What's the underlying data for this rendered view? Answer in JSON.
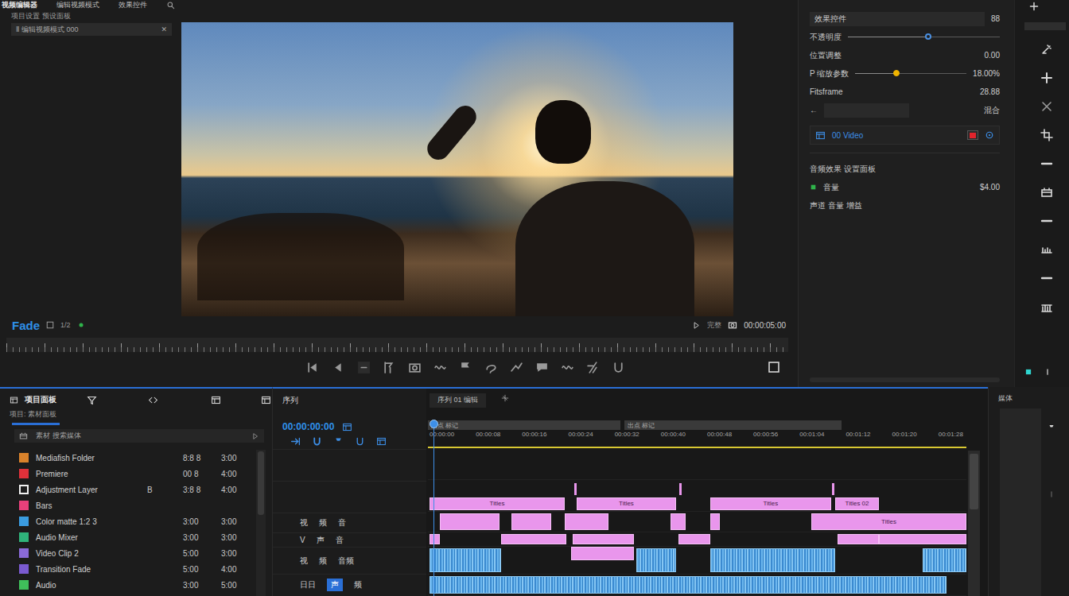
{
  "editor": {
    "title": "视频编辑器",
    "menu": [
      "编辑视频模式",
      "效果控件"
    ],
    "subtitle": "项目设置 预设面板",
    "preset_field": {
      "value": "Ⅱ 编辑视频模式 000",
      "clear": "✕"
    }
  },
  "viewer": {
    "clip_name": "Fade",
    "zoom": "1/2",
    "view_mode": "完整",
    "timecode": "00:00:05:00"
  },
  "effect_controls": {
    "header": {
      "label": "效果控件",
      "value": "88"
    },
    "params": [
      {
        "kind": "slider",
        "label": "不透明度",
        "level": 0.53,
        "color": "#4a8fe0"
      },
      {
        "kind": "value",
        "label": "位置调整",
        "value": "0.00"
      },
      {
        "kind": "slider",
        "label": "P 缩放参数",
        "level": 0.37,
        "color": "#f0b400",
        "value": "18.00%"
      },
      {
        "kind": "value",
        "label": "Fitsframe",
        "value": "28.88"
      },
      {
        "kind": "dropdown",
        "label": "←",
        "value": "混合"
      }
    ],
    "keyframe": {
      "label": "00 Video",
      "record_on": true
    },
    "audio": {
      "title": "音频效果 设置面板",
      "rows": [
        {
          "label": "音量",
          "value": "$4.00"
        },
        {
          "label": "声道 音量 增益"
        }
      ]
    }
  },
  "project": {
    "title": "项目面板",
    "subtitle": "项目: 素材面板",
    "search": "素材 搜索媒体",
    "items": [
      {
        "name": "Mediafish Folder",
        "a": "8:8 8",
        "b": "3:00",
        "color": "#d9822b"
      },
      {
        "name": "Premiere",
        "a": "00 8",
        "b": "4:00",
        "color": "#e0313a"
      },
      {
        "name": "Adjustment Layer",
        "ex": "B",
        "a": "3:8 8",
        "b": "4:00",
        "color": "#f0f0f0"
      },
      {
        "name": "Bars",
        "color": "#e8407a"
      },
      {
        "name": "Color matte 1:2 3",
        "a": "3:00",
        "b": "3:00",
        "color": "#3a9be0"
      },
      {
        "name": "Audio Mixer",
        "a": "3:00",
        "b": "3:00",
        "color": "#2fb37a"
      },
      {
        "name": "Video Clip 2",
        "a": "5:00",
        "b": "3:00",
        "color": "#8a6ad8"
      },
      {
        "name": "Transition Fade",
        "a": "5:00",
        "b": "4:00",
        "color": "#7a5ad0"
      },
      {
        "name": "Audio",
        "a": "3:00",
        "b": "5:00",
        "color": "#3fbf5a"
      }
    ]
  },
  "timeline": {
    "title": "序列",
    "sequence_tab": "序列 01 编辑",
    "timecode": "00:00:00:00",
    "ranges": [
      {
        "start": 0,
        "end": 35.7,
        "label": "入点 标记"
      },
      {
        "start": 36.5,
        "end": 76.8,
        "label": "出点 标记"
      }
    ],
    "ruler": [
      "00:00:00",
      "00:00:08",
      "00:00:16",
      "00:00:24",
      "00:00:32",
      "00:00:40",
      "00:00:48",
      "00:00:56",
      "00:01:04",
      "00:01:12",
      "00:01:20",
      "00:01:28"
    ],
    "playhead": 1,
    "tracks": [
      {
        "header": [],
        "markers": [],
        "clips": []
      },
      {
        "header": [],
        "markers": [
          27.3,
          46.8,
          75.2
        ],
        "clips": [
          {
            "kind": "video",
            "start": 0.3,
            "end": 25.4,
            "label": "Titles"
          },
          {
            "kind": "video",
            "start": 27.6,
            "end": 46.1,
            "label": "Titles"
          },
          {
            "kind": "video",
            "start": 52.4,
            "end": 74.9,
            "label": "Titles"
          },
          {
            "kind": "video",
            "start": 75.6,
            "end": 83.8,
            "label": "Titles 02"
          }
        ]
      },
      {
        "header": [
          {
            "text": "视",
            "selected": false
          },
          {
            "text": "频",
            "selected": false
          },
          {
            "text": "音",
            "selected": false
          }
        ],
        "markers": [],
        "clips": [
          {
            "kind": "video",
            "start": 2.2,
            "end": 13.3
          },
          {
            "kind": "video",
            "start": 15.5,
            "end": 22.9
          },
          {
            "kind": "video",
            "start": 25.4,
            "end": 33.5
          },
          {
            "kind": "video",
            "start": 45.1,
            "end": 47.9
          },
          {
            "kind": "video",
            "start": 52.4,
            "end": 54.2
          },
          {
            "kind": "video",
            "start": 71.2,
            "end": 100,
            "label": "Titles"
          }
        ]
      },
      {
        "header": [
          {
            "text": "V",
            "selected": false
          },
          {
            "text": "声",
            "selected": false
          },
          {
            "text": "音",
            "selected": false
          }
        ],
        "markers": [],
        "clips": [
          {
            "kind": "video",
            "start": 0.3,
            "end": 2.2
          },
          {
            "kind": "video",
            "start": 13.6,
            "end": 25.7
          },
          {
            "kind": "video",
            "start": 26.9,
            "end": 38.3
          },
          {
            "kind": "video",
            "start": 46.5,
            "end": 52.4
          },
          {
            "kind": "video",
            "start": 76.1,
            "end": 83.8
          },
          {
            "kind": "video",
            "start": 83.8,
            "end": 100
          }
        ]
      },
      {
        "header": [
          {
            "text": "视",
            "selected": false
          },
          {
            "text": "频",
            "selected": false
          },
          {
            "text": "音频",
            "selected": false
          }
        ],
        "markers": [],
        "clips": [
          {
            "kind": "audio",
            "start": 0.3,
            "end": 13.6
          },
          {
            "kind": "video",
            "start": 26.6,
            "end": 38.3
          },
          {
            "kind": "audio",
            "start": 38.7,
            "end": 46.1
          },
          {
            "kind": "audio",
            "start": 52.4,
            "end": 75.6
          },
          {
            "kind": "audio",
            "start": 91.9,
            "end": 100
          }
        ]
      },
      {
        "header": [
          {
            "text": "日日",
            "selected": false
          },
          {
            "text": "声",
            "selected": true
          },
          {
            "text": "频",
            "selected": false
          }
        ],
        "markers": [],
        "clips": [
          {
            "kind": "audio",
            "start": 0.3,
            "end": 96.3
          }
        ]
      }
    ]
  },
  "media_panel": {
    "title": "媒体"
  }
}
